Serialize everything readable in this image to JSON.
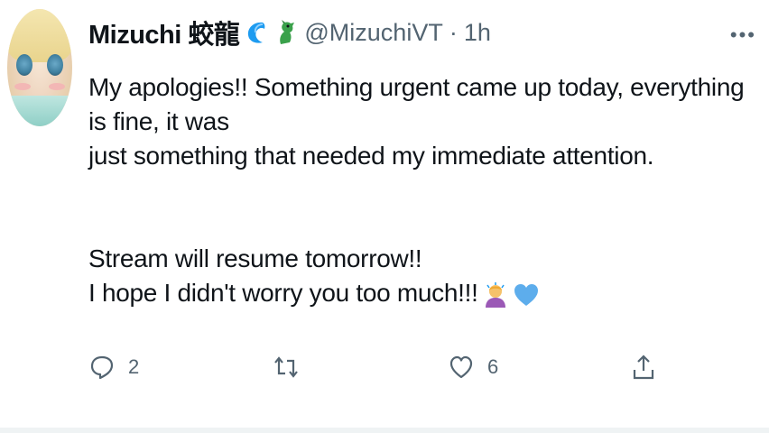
{
  "tweet": {
    "author": {
      "display_name": "Mizuchi 蛟龍",
      "handle": "@MizuchiVT",
      "time": "1h",
      "separator": "·"
    },
    "body": {
      "line1": "My apologies!! Something urgent came up today, everything is fine, it was",
      "line2": "just something that needed my immediate attention.",
      "line3": "Stream will resume tomorrow!!",
      "line4": "I hope I didn't worry you too much!!!"
    },
    "emoji": [
      "person-bowing-emoji",
      "blue-heart-emoji"
    ],
    "actions": {
      "reply_count": "2",
      "retweet_count": "",
      "like_count": "6"
    },
    "more_label": "•••",
    "colors": {
      "text": "#0f1419",
      "secondary": "#536471",
      "wave": "#1d9bf0",
      "dragon": "#3aa14b"
    }
  }
}
